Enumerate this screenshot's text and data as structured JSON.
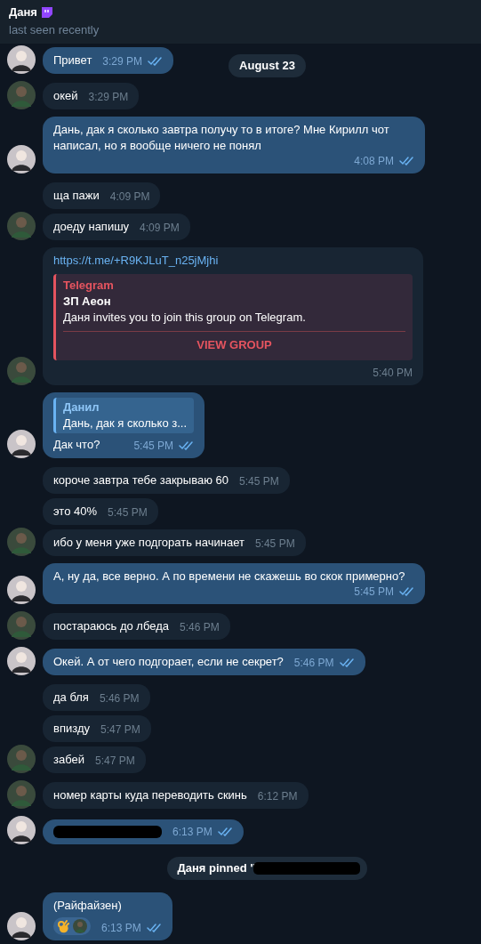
{
  "header": {
    "name": "Даня",
    "status": "last seen recently"
  },
  "items": [
    {
      "kind": "message",
      "outgoing": true,
      "avatar": true,
      "text": "Привет",
      "time": "3:29 PM",
      "read": true
    },
    {
      "kind": "date",
      "text": "August 23"
    },
    {
      "kind": "message",
      "outgoing": false,
      "avatar": true,
      "text": "окей",
      "time": "3:29 PM"
    },
    {
      "kind": "message",
      "outgoing": true,
      "avatar": true,
      "text": "Дань, дак я сколько завтра получу то в итоге? Мне Кирилл чот написал, но я вообще ничего не понял",
      "time": "4:08 PM",
      "read": true
    },
    {
      "kind": "message",
      "outgoing": false,
      "avatar": false,
      "text": "ща пажи",
      "time": "4:09 PM"
    },
    {
      "kind": "message",
      "outgoing": false,
      "avatar": true,
      "text": "доеду напишу",
      "time": "4:09 PM"
    },
    {
      "kind": "link",
      "outgoing": false,
      "avatar": true,
      "link": "https://t.me/+R9KJLuT_n25jMjhi",
      "preview": {
        "site": "Telegram",
        "title": "ЗП Аеон",
        "description": "Даня invites you to join this group on Telegram.",
        "button": "VIEW GROUP"
      },
      "time": "5:40 PM"
    },
    {
      "kind": "reply",
      "outgoing": true,
      "avatar": true,
      "reply": {
        "author": "Данил",
        "text": "Дань, дак я сколько з..."
      },
      "text": "Дак что?",
      "time": "5:45 PM",
      "read": true
    },
    {
      "kind": "message",
      "outgoing": false,
      "avatar": false,
      "text": "короче завтра тебе закрываю 60",
      "time": "5:45 PM"
    },
    {
      "kind": "message",
      "outgoing": false,
      "avatar": false,
      "text": "это 40%",
      "time": "5:45 PM"
    },
    {
      "kind": "message",
      "outgoing": false,
      "avatar": true,
      "text": "ибо у меня уже подгорать начинает",
      "time": "5:45 PM"
    },
    {
      "kind": "message",
      "outgoing": true,
      "avatar": true,
      "text": "А, ну да, все верно. А по времени не скажешь во скок примерно?",
      "time": "5:45 PM",
      "read": true
    },
    {
      "kind": "message",
      "outgoing": false,
      "avatar": true,
      "text": "постараюсь до лбеда",
      "time": "5:46 PM"
    },
    {
      "kind": "message",
      "outgoing": true,
      "avatar": true,
      "text": "Окей. А от чего подгорает, если не секрет?",
      "time": "5:46 PM",
      "read": true
    },
    {
      "kind": "message",
      "outgoing": false,
      "avatar": false,
      "text": "да бля",
      "time": "5:46 PM"
    },
    {
      "kind": "message",
      "outgoing": false,
      "avatar": false,
      "text": "впизду",
      "time": "5:47 PM"
    },
    {
      "kind": "message",
      "outgoing": false,
      "avatar": true,
      "text": "забей",
      "time": "5:47 PM"
    },
    {
      "kind": "message",
      "outgoing": false,
      "avatar": true,
      "text": "номер карты куда переводить скинь",
      "time": "6:12 PM"
    },
    {
      "kind": "redacted",
      "outgoing": true,
      "avatar": true,
      "time": "6:13 PM",
      "read": true
    },
    {
      "kind": "service",
      "text": "Даня pinned \"",
      "redacted": true
    },
    {
      "kind": "reaction",
      "outgoing": true,
      "avatar": true,
      "text": "(Райфайзен)",
      "time": "6:13 PM",
      "read": true
    }
  ]
}
